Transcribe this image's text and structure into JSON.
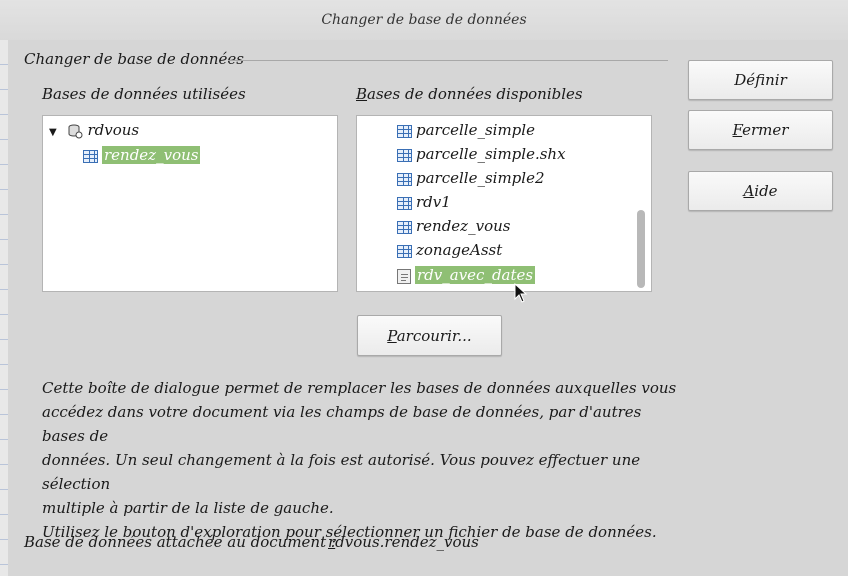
{
  "window": {
    "title": "Changer de base de données"
  },
  "group": {
    "title": "Changer de base de données"
  },
  "used": {
    "label": "Bases de données utilisées",
    "tree": {
      "root": "rdvous",
      "children": [
        "rendez_vous"
      ]
    }
  },
  "available": {
    "label_first": "B",
    "label_rest": "ases de données disponibles",
    "items": [
      "parcelle_simple",
      "parcelle_simple.shx",
      "parcelle_simple2",
      "rdv1",
      "rendez_vous",
      "zonageAsst",
      "rdv_avec_dates"
    ],
    "selected": "rdv_avec_dates"
  },
  "buttons": {
    "define": "Définir",
    "close_first": "F",
    "close_rest": "ermer",
    "help_first": "A",
    "help_rest": "ide",
    "browse_first": "P",
    "browse_rest": "arcourir..."
  },
  "description": {
    "line1": "Cette boîte de dialogue permet de remplacer les bases de données auxquelles vous",
    "line2": "accédez dans votre document via les champs de base de données, par d'autres bases de",
    "line3": "données. Un seul changement à la fois est autorisé. Vous pouvez effectuer une sélection",
    "line4": "multiple à partir de la liste de gauche.",
    "line5": "Utilisez le bouton d'exploration pour sélectionner un fichier de base de données."
  },
  "footer": {
    "label": "Base de données attachée au document :",
    "value_first": "r",
    "value_rest": "dvous.rendez_vous"
  },
  "colors": {
    "selection": "#8fbf74",
    "icon_blue": "#3a6fb5"
  }
}
